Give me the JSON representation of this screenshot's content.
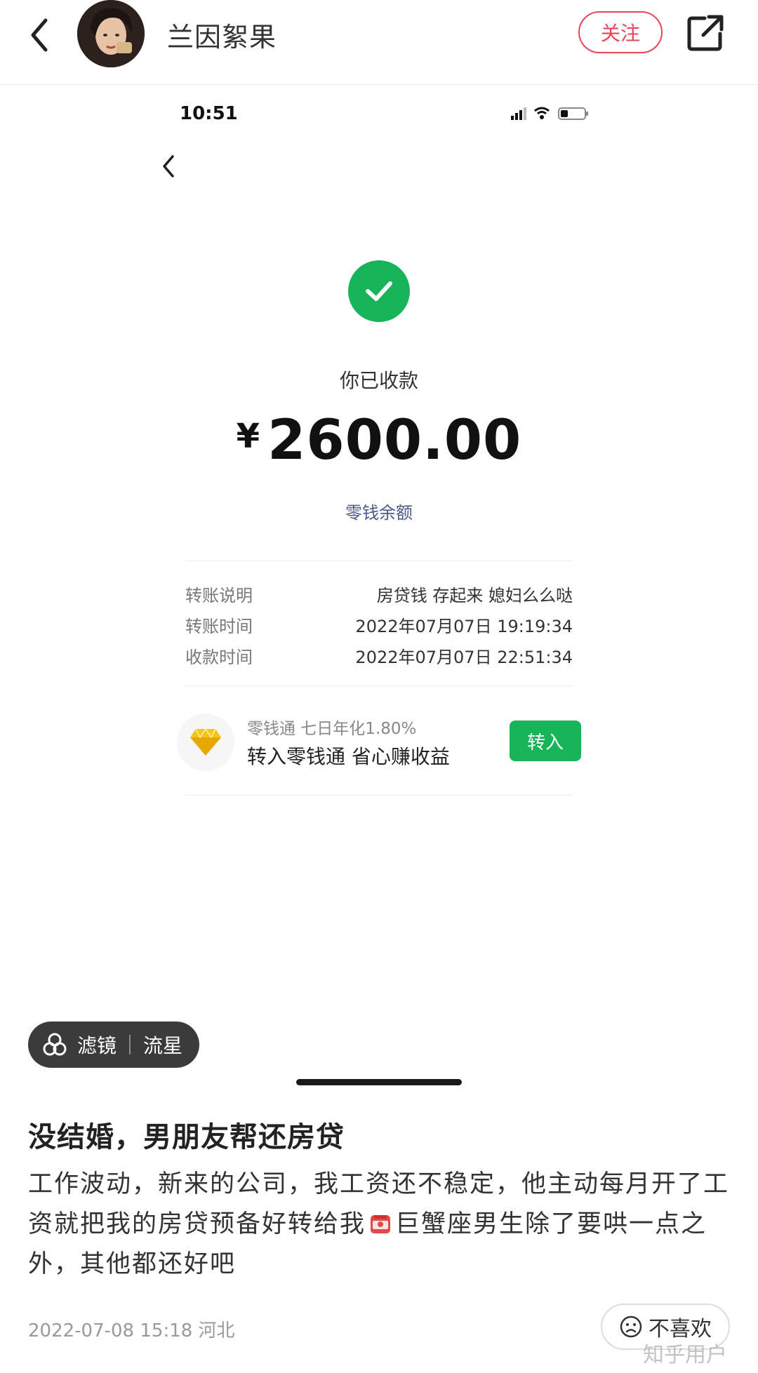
{
  "header": {
    "username": "兰因絮果",
    "follow_label": "关注",
    "icons": {
      "back": "back-chevron-icon",
      "share": "share-external-icon",
      "avatar": "user-avatar"
    }
  },
  "screenshot": {
    "status_time": "10:51",
    "status_icons": [
      "signal-icon",
      "wifi-icon",
      "battery-icon"
    ],
    "status_label": "你已收款",
    "currency": "¥",
    "amount": "2600.00",
    "balance_link": "零钱余额",
    "details": [
      {
        "key": "转账说明",
        "value": "房贷钱 存起来 媳妇么么哒"
      },
      {
        "key": "转账时间",
        "value": "2022年07月07日 19:19:34"
      },
      {
        "key": "收款时间",
        "value": "2022年07月07日 22:51:34"
      }
    ],
    "promo": {
      "subtitle": "零钱通 七日年化1.80%",
      "title": "转入零钱通 省心赚收益",
      "button": "转入",
      "icon": "diamond-icon"
    },
    "colors": {
      "accent_green": "#17b45a",
      "link_blue": "#4a5a8a"
    }
  },
  "filter": {
    "label": "滤镜",
    "value": "流星",
    "icon": "filter-circles-icon"
  },
  "post": {
    "title": "没结婚，男朋友帮还房贷",
    "body_part1": "工作波动，新来的公司，我工资还不稳定，他主动每月开了工资就把我的房贷预备好转给我",
    "body_part2": "巨蟹座男生除了要哄一点之外，其他都还好吧",
    "emoji": "red-envelope-emoji",
    "meta": "2022-07-08 15:18 河北",
    "dislike_label": "不喜欢",
    "watermark": "知乎用户"
  },
  "colors": {
    "brand_red": "#e8455a"
  }
}
